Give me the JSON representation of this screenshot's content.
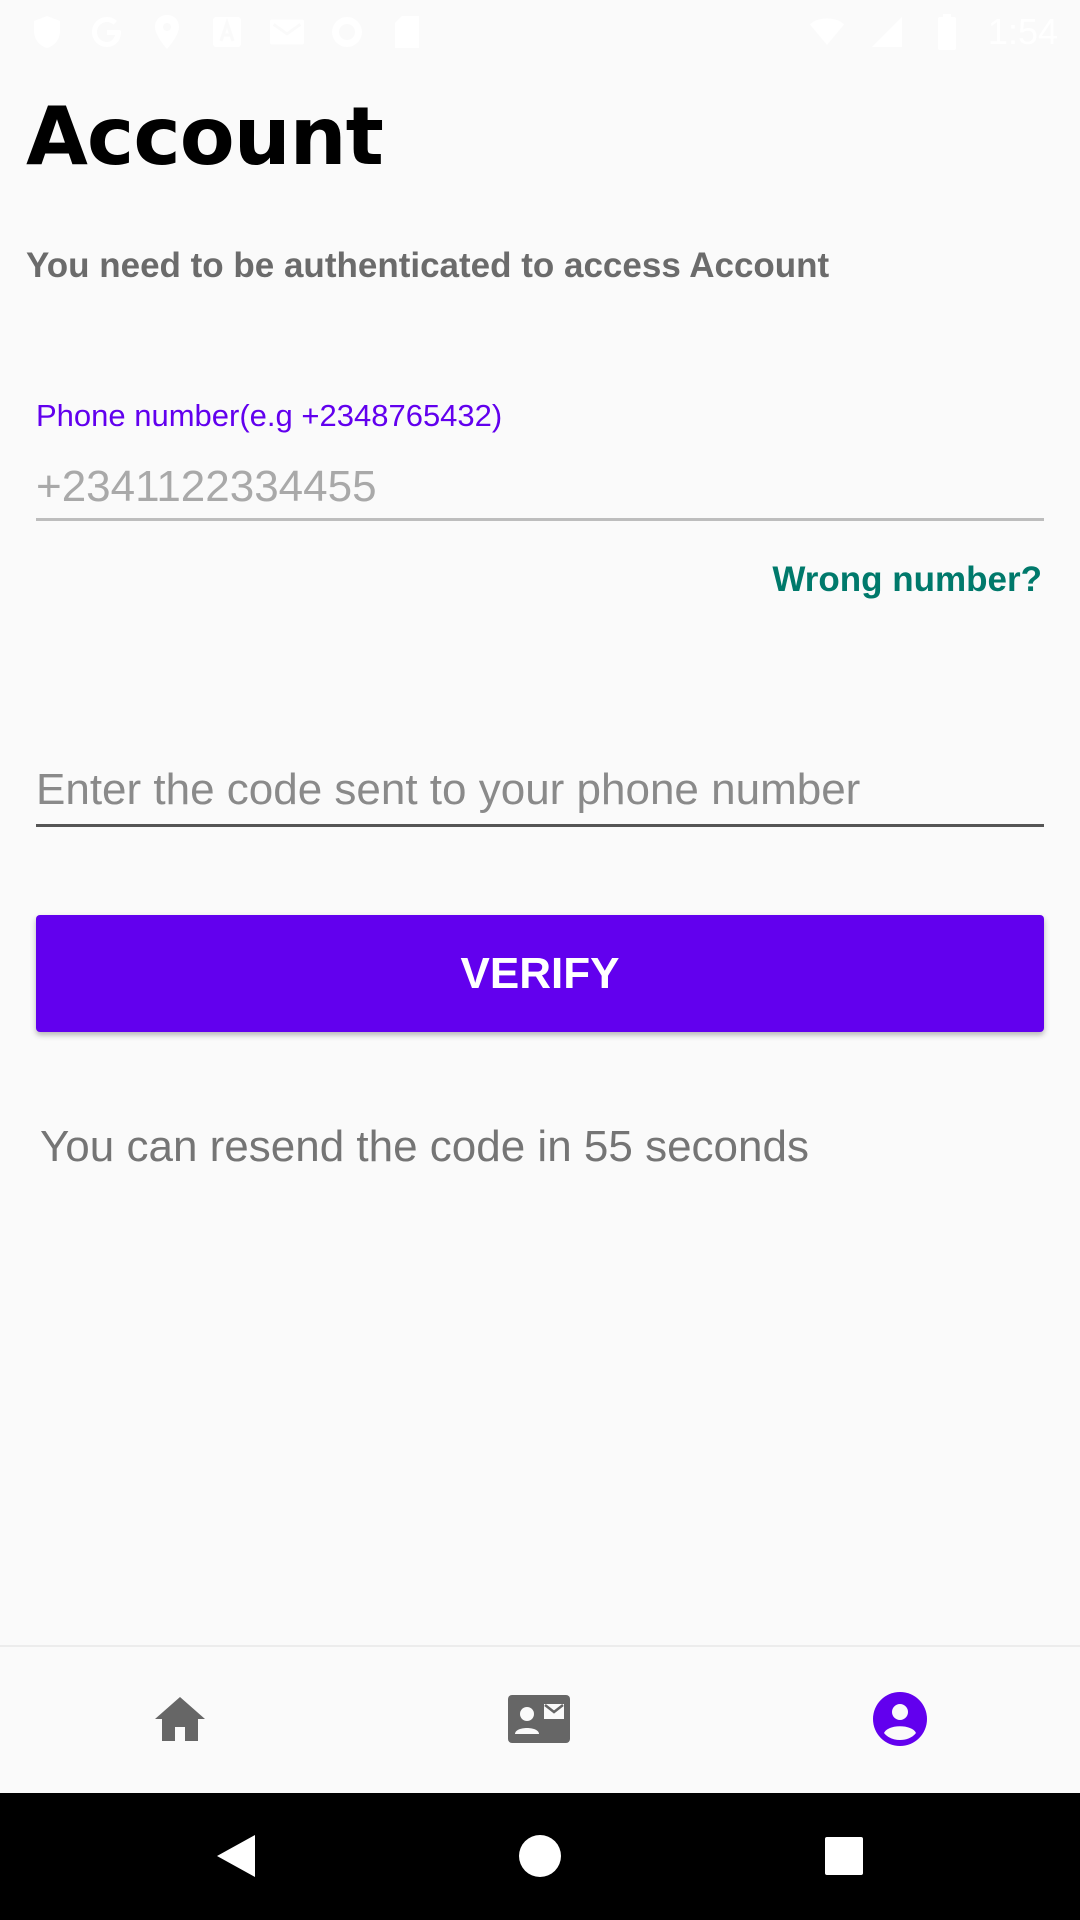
{
  "status_bar": {
    "time": "1:54",
    "left_icons": [
      "shield-icon",
      "google-icon",
      "location-icon",
      "text-icon",
      "gmail-icon",
      "sync-icon",
      "sd-card-icon"
    ],
    "right_icons": [
      "wifi-icon",
      "signal-icon",
      "battery-icon"
    ]
  },
  "page": {
    "title": "Account",
    "auth_message": "You need to be authenticated to access Account"
  },
  "phone_field": {
    "label": "Phone number(e.g +2348765432)",
    "placeholder": "+2341122334455",
    "value": ""
  },
  "wrong_number_link": "Wrong number?",
  "code_field": {
    "placeholder": "Enter the code sent to your phone number",
    "value": ""
  },
  "verify_button": "VERIFY",
  "resend_message": "You can resend the code in 55 seconds",
  "bottom_nav": {
    "items": [
      {
        "icon": "home-icon",
        "active": false
      },
      {
        "icon": "contact-card-icon",
        "active": false
      },
      {
        "icon": "account-circle-icon",
        "active": true
      }
    ],
    "active_color": "#6200ee",
    "inactive_color": "#666666"
  },
  "colors": {
    "primary": "#6200ee",
    "link": "#00796b",
    "background": "#fafafa"
  }
}
